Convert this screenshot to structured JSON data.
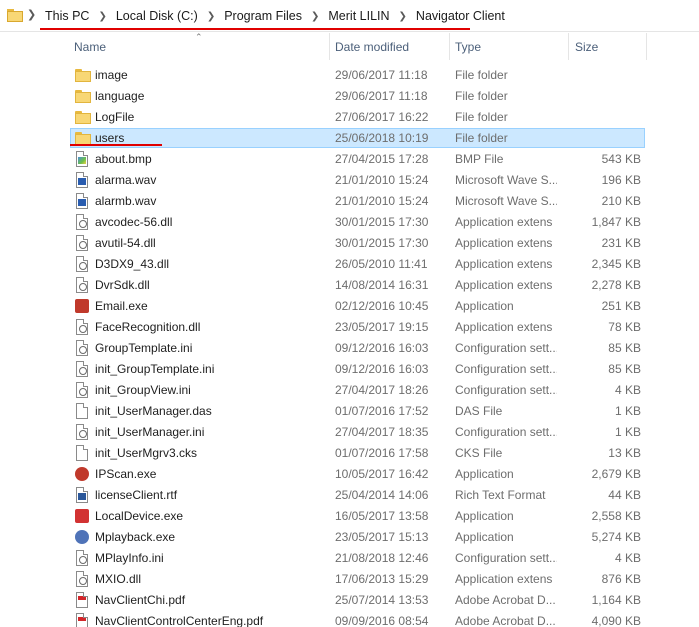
{
  "address_bar": {
    "crumbs": [
      "This PC",
      "Local Disk (C:)",
      "Program Files",
      "Merit LILIN",
      "Navigator Client"
    ]
  },
  "columns": {
    "name": "Name",
    "date": "Date modified",
    "type": "Type",
    "size": "Size"
  },
  "files": [
    {
      "name": "image",
      "date": "29/06/2017 11:18",
      "type": "File folder",
      "size": "",
      "icon": "folder-icon"
    },
    {
      "name": "language",
      "date": "29/06/2017 11:18",
      "type": "File folder",
      "size": "",
      "icon": "folder-icon"
    },
    {
      "name": "LogFile",
      "date": "27/06/2017 16:22",
      "type": "File folder",
      "size": "",
      "icon": "folder-icon"
    },
    {
      "name": "users",
      "date": "25/06/2018 10:19",
      "type": "File folder",
      "size": "",
      "icon": "folder-icon",
      "selected": true
    },
    {
      "name": "about.bmp",
      "date": "27/04/2015 17:28",
      "type": "BMP File",
      "size": "543 KB",
      "icon": "bmp-file-icon"
    },
    {
      "name": "alarma.wav",
      "date": "21/01/2010 15:24",
      "type": "Microsoft Wave S...",
      "size": "196 KB",
      "icon": "wave-file-icon"
    },
    {
      "name": "alarmb.wav",
      "date": "21/01/2010 15:24",
      "type": "Microsoft Wave S...",
      "size": "210 KB",
      "icon": "wave-file-icon"
    },
    {
      "name": "avcodec-56.dll",
      "date": "30/01/2015 17:30",
      "type": "Application extens",
      "size": "1,847 KB",
      "icon": "dll-file-icon"
    },
    {
      "name": "avutil-54.dll",
      "date": "30/01/2015 17:30",
      "type": "Application extens",
      "size": "231 KB",
      "icon": "dll-file-icon"
    },
    {
      "name": "D3DX9_43.dll",
      "date": "26/05/2010 11:41",
      "type": "Application extens",
      "size": "2,345 KB",
      "icon": "dll-file-icon"
    },
    {
      "name": "DvrSdk.dll",
      "date": "14/08/2014 16:31",
      "type": "Application extens",
      "size": "2,278 KB",
      "icon": "dll-file-icon"
    },
    {
      "name": "Email.exe",
      "date": "02/12/2016 10:45",
      "type": "Application",
      "size": "251 KB",
      "icon": "email-app-icon"
    },
    {
      "name": "FaceRecognition.dll",
      "date": "23/05/2017 19:15",
      "type": "Application extens",
      "size": "78 KB",
      "icon": "dll-file-icon"
    },
    {
      "name": "GroupTemplate.ini",
      "date": "09/12/2016 16:03",
      "type": "Configuration sett...",
      "size": "85 KB",
      "icon": "ini-file-icon"
    },
    {
      "name": "init_GroupTemplate.ini",
      "date": "09/12/2016 16:03",
      "type": "Configuration sett...",
      "size": "85 KB",
      "icon": "ini-file-icon"
    },
    {
      "name": "init_GroupView.ini",
      "date": "27/04/2017 18:26",
      "type": "Configuration sett...",
      "size": "4 KB",
      "icon": "ini-file-icon"
    },
    {
      "name": "init_UserManager.das",
      "date": "01/07/2016 17:52",
      "type": "DAS File",
      "size": "1 KB",
      "icon": "blank-file-icon"
    },
    {
      "name": "init_UserManager.ini",
      "date": "27/04/2017 18:35",
      "type": "Configuration sett...",
      "size": "1 KB",
      "icon": "ini-file-icon"
    },
    {
      "name": "init_UserMgrv3.cks",
      "date": "01/07/2016 17:58",
      "type": "CKS File",
      "size": "13 KB",
      "icon": "blank-file-icon"
    },
    {
      "name": "IPScan.exe",
      "date": "10/05/2017 16:42",
      "type": "Application",
      "size": "2,679 KB",
      "icon": "ipscan-app-icon"
    },
    {
      "name": "licenseClient.rtf",
      "date": "25/04/2014 14:06",
      "type": "Rich Text Format",
      "size": "44 KB",
      "icon": "rtf-file-icon"
    },
    {
      "name": "LocalDevice.exe",
      "date": "16/05/2017 13:58",
      "type": "Application",
      "size": "2,558 KB",
      "icon": "localdevice-app-icon"
    },
    {
      "name": "Mplayback.exe",
      "date": "23/05/2017 15:13",
      "type": "Application",
      "size": "5,274 KB",
      "icon": "mplayback-app-icon"
    },
    {
      "name": "MPlayInfo.ini",
      "date": "21/08/2018 12:46",
      "type": "Configuration sett...",
      "size": "4 KB",
      "icon": "ini-file-icon"
    },
    {
      "name": "MXIO.dll",
      "date": "17/06/2013 15:29",
      "type": "Application extens",
      "size": "876 KB",
      "icon": "dll-file-icon"
    },
    {
      "name": "NavClientChi.pdf",
      "date": "25/07/2014 13:53",
      "type": "Adobe Acrobat D...",
      "size": "1,164 KB",
      "icon": "pdf-file-icon"
    },
    {
      "name": "NavClientControlCenterEng.pdf",
      "date": "09/09/2016 08:54",
      "type": "Adobe Acrobat D...",
      "size": "4,090 KB",
      "icon": "pdf-file-icon"
    }
  ]
}
